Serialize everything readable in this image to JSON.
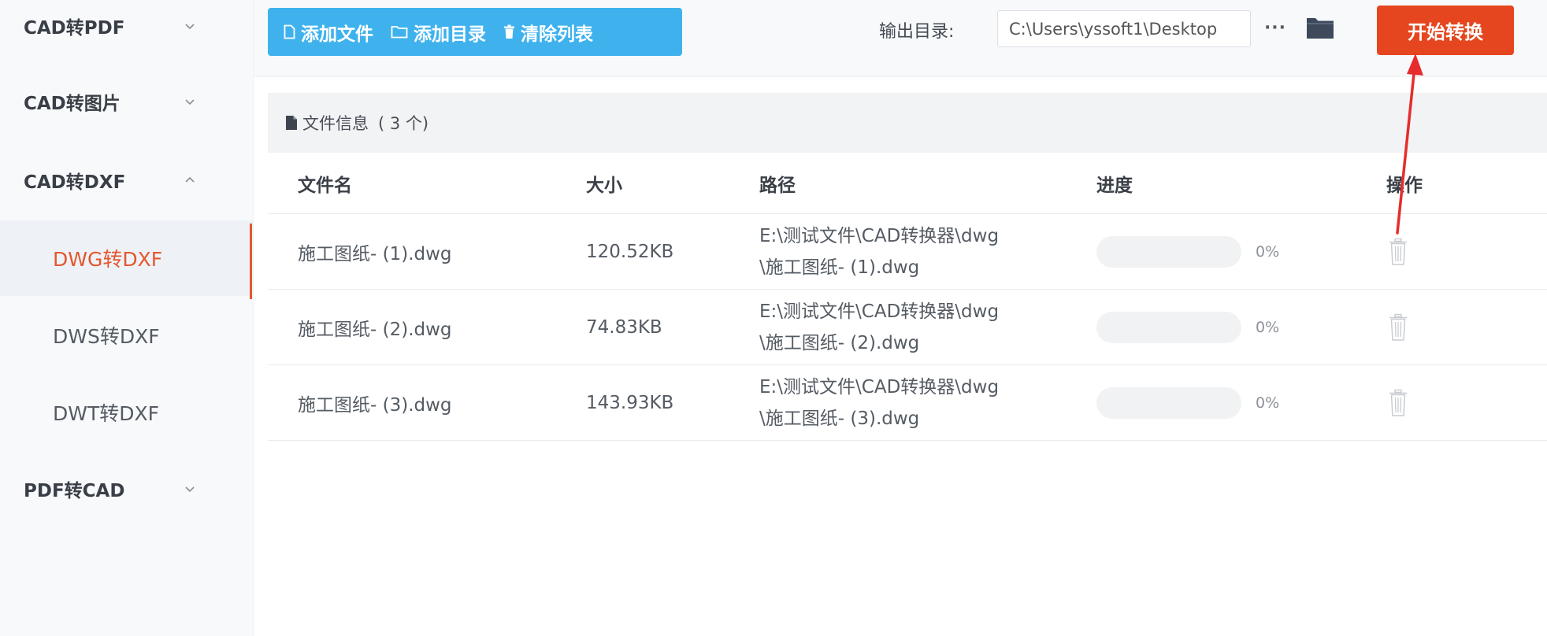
{
  "sidebar": {
    "groups": [
      {
        "label": "CAD转PDF",
        "expanded": false
      },
      {
        "label": "CAD转图片",
        "expanded": false
      },
      {
        "label": "CAD转DXF",
        "expanded": true,
        "items": [
          {
            "label": "DWG转DXF",
            "active": true
          },
          {
            "label": "DWS转DXF",
            "active": false
          },
          {
            "label": "DWT转DXF",
            "active": false
          }
        ]
      },
      {
        "label": "PDF转CAD",
        "expanded": false
      }
    ]
  },
  "toolbar": {
    "add_file_label": "添加文件",
    "add_dir_label": "添加目录",
    "clear_list_label": "清除列表",
    "output_label": "输出目录:",
    "output_path": "C:\\Users\\yssoft1\\Desktop",
    "more_label": "···",
    "start_label": "开始转换"
  },
  "file_info": {
    "label": "文件信息",
    "count_text": "( 3 个)"
  },
  "table": {
    "columns": {
      "name": "文件名",
      "size": "大小",
      "path": "路径",
      "progress": "进度",
      "action": "操作"
    },
    "rows": [
      {
        "name": "施工图纸- (1).dwg",
        "size": "120.52KB",
        "path": "E:\\测试文件\\CAD转换器\\dwg\\施工图纸- (1).dwg",
        "progress": 0,
        "progress_text": "0%"
      },
      {
        "name": "施工图纸- (2).dwg",
        "size": "74.83KB",
        "path": "E:\\测试文件\\CAD转换器\\dwg\\施工图纸- (2).dwg",
        "progress": 0,
        "progress_text": "0%"
      },
      {
        "name": "施工图纸- (3).dwg",
        "size": "143.93KB",
        "path": "E:\\测试文件\\CAD转换器\\dwg\\施工图纸- (3).dwg",
        "progress": 0,
        "progress_text": "0%"
      }
    ]
  },
  "colors": {
    "accent_blue": "#3fb2ee",
    "start_red": "#e5461f",
    "active_orange": "#e4572e",
    "annotation_red": "#e62c2c"
  },
  "icons": {
    "add_file": "file-icon",
    "add_dir": "folder-outline-icon",
    "clear_list": "trash-icon",
    "output_browse": "folder-icon",
    "row_delete": "trash-icon",
    "info": "document-icon"
  }
}
